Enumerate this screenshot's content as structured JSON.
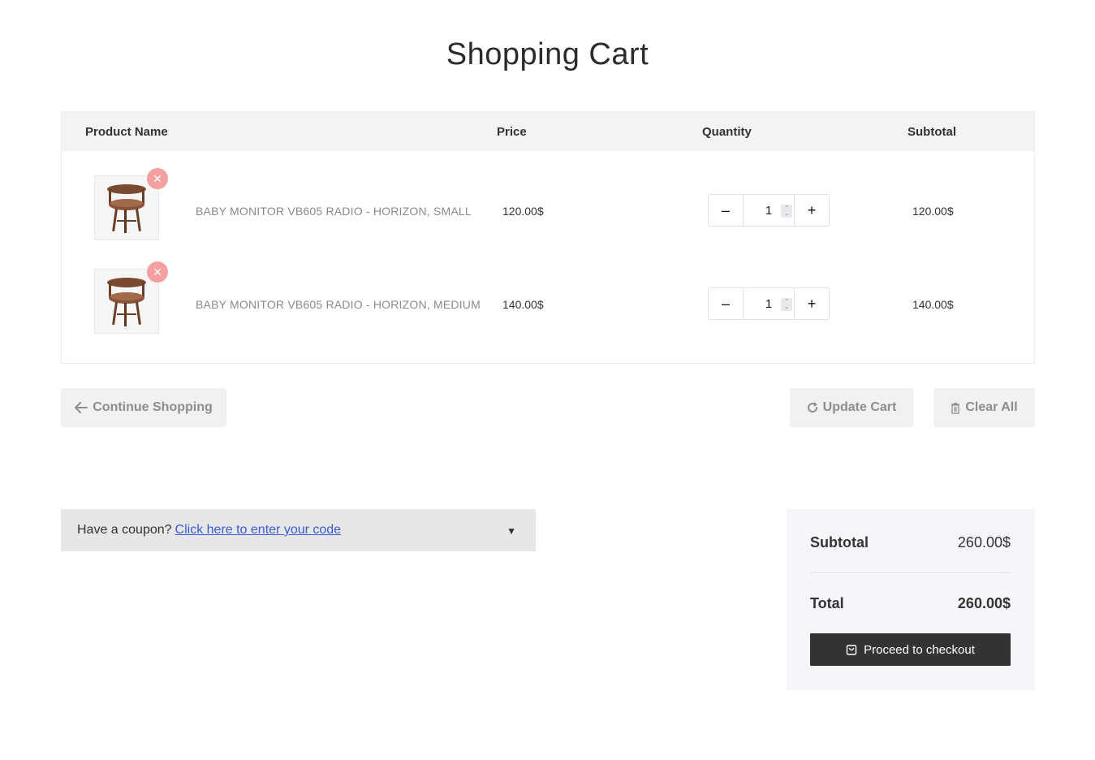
{
  "page": {
    "title": "Shopping Cart"
  },
  "table": {
    "headers": {
      "name": "Product Name",
      "price": "Price",
      "quantity": "Quantity",
      "subtotal": "Subtotal"
    },
    "rows": [
      {
        "name": "BABY MONITOR VB605 RADIO - HORIZON, SMALL",
        "price": "120.00$",
        "quantity": "1",
        "subtotal": "120.00$"
      },
      {
        "name": "BABY MONITOR VB605 RADIO - HORIZON, MEDIUM",
        "price": "140.00$",
        "quantity": "1",
        "subtotal": "140.00$"
      }
    ]
  },
  "actions": {
    "continue": "Continue Shopping",
    "update": "Update Cart",
    "clear": "Clear All"
  },
  "coupon": {
    "prompt": "Have a coupon?",
    "link": "Click here to enter your code"
  },
  "totals": {
    "subtotal_label": "Subtotal",
    "subtotal_value": "260.00$",
    "total_label": "Total",
    "total_value": "260.00$",
    "checkout": "Proceed to checkout"
  },
  "colors": {
    "remove": "#f5a0a0",
    "checkout_bg": "#333333",
    "link": "#3a5bd9"
  },
  "icons": {
    "remove": "close-icon",
    "qty_minus": "minus-icon",
    "qty_plus": "plus-icon",
    "continue": "arrow-left-icon",
    "update": "refresh-icon",
    "clear": "trash-icon",
    "coupon": "caret-down-icon",
    "checkout": "shopping-bag-icon"
  }
}
